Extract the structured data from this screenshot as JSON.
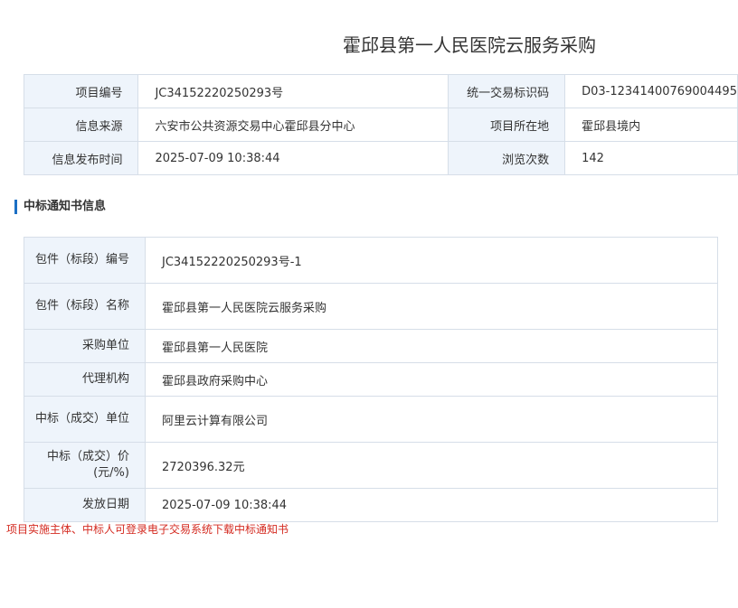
{
  "page_title": "霍邱县第一人民医院云服务采购",
  "project_info": {
    "project_no_label": "项目编号",
    "project_no": "JC34152220250293号",
    "trade_code_label": "统一交易标识码",
    "trade_code": "D03-12341400769004495",
    "source_label": "信息来源",
    "source": "六安市公共资源交易中心霍邱县分中心",
    "location_label": "项目所在地",
    "location": "霍邱县境内",
    "publish_time_label": "信息发布时间",
    "publish_time": "2025-07-09 10:38:44",
    "views_label": "浏览次数",
    "views": "142"
  },
  "section_title": "中标通知书信息",
  "notice": {
    "rows": [
      {
        "label": "包件（标段）编号",
        "value": "JC34152220250293号-1"
      },
      {
        "label": "包件（标段）名称",
        "value": "霍邱县第一人民医院云服务采购"
      },
      {
        "label": "采购单位",
        "value": "霍邱县第一人民医院"
      },
      {
        "label": "代理机构",
        "value": "霍邱县政府采购中心"
      },
      {
        "label": "中标（成交）单位",
        "value": "阿里云计算有限公司"
      },
      {
        "label": "中标（成交）价(元/%)",
        "value": "2720396.32元"
      },
      {
        "label": "发放日期",
        "value": "2025-07-09 10:38:44"
      }
    ]
  },
  "footnote": "项目实施主体、中标人可登录电子交易系统下载中标通知书"
}
